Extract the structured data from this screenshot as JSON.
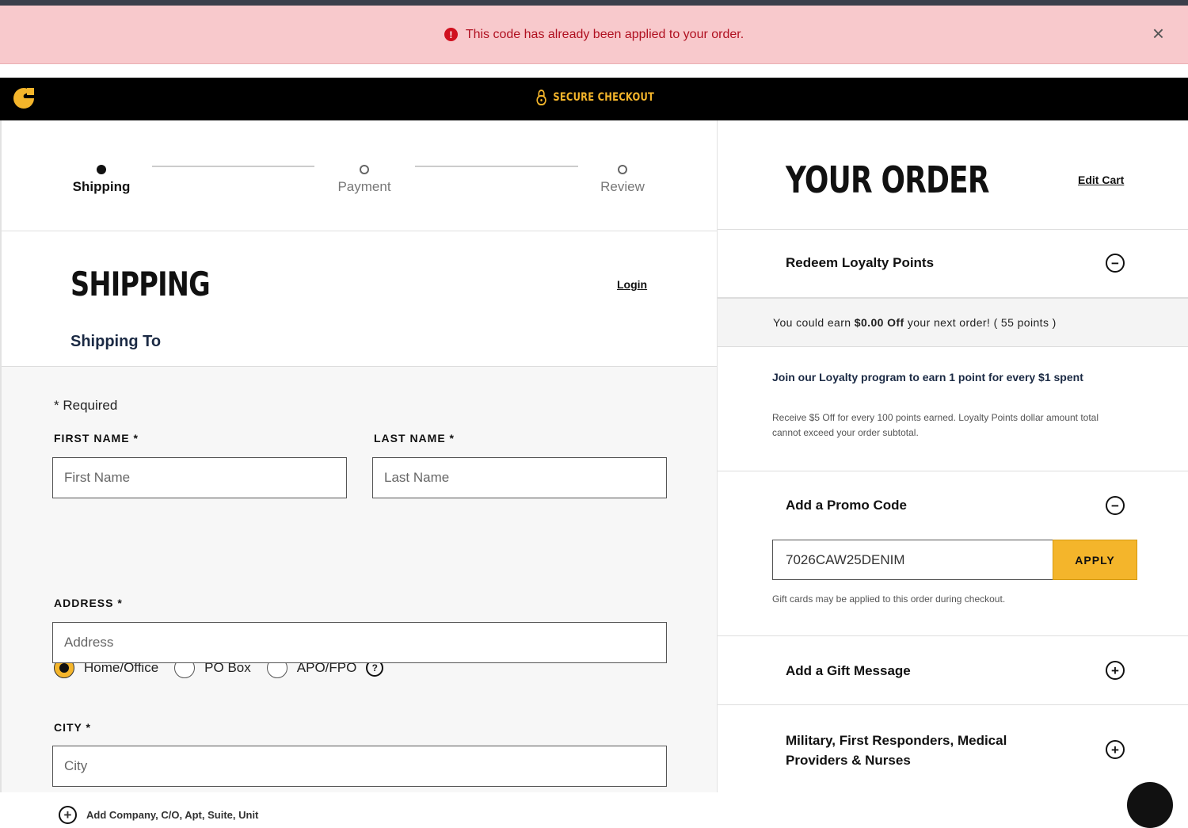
{
  "alert": {
    "message": "This code has already been applied to your order.",
    "icon": "error-icon",
    "close": "×"
  },
  "header": {
    "secure_label": "SECURE CHECKOUT",
    "accent": "#f4b52b"
  },
  "stepper": {
    "steps": [
      {
        "label": "Shipping",
        "active": true
      },
      {
        "label": "Payment",
        "active": false
      },
      {
        "label": "Review",
        "active": false
      }
    ]
  },
  "shipping": {
    "title": "SHIPPING",
    "login": "Login",
    "shipping_to": "Shipping To",
    "required_note": "* Required",
    "first_name_label": "FIRST NAME *",
    "first_name_placeholder": "First Name",
    "last_name_label": "LAST NAME *",
    "last_name_placeholder": "Last Name",
    "address_types": [
      "Home/Office",
      "PO Box",
      "APO/FPO"
    ],
    "selected_address_type": "Home/Office",
    "help": "?",
    "address_label": "ADDRESS *",
    "address_placeholder": "Address",
    "add_company": "Add Company, C/O, Apt, Suite, Unit",
    "city_label": "CITY *",
    "city_placeholder": "City"
  },
  "order": {
    "title": "YOUR ORDER",
    "edit_cart": "Edit Cart",
    "loyalty": {
      "title": "Redeem Loyalty Points",
      "earn_prefix": "You could earn ",
      "earn_amount": "$0.00 Off",
      "earn_suffix": " your next order! ( 55 points )",
      "join_title": "Join our Loyalty program to earn 1 point for every $1 spent",
      "description": "Receive $5 Off for every 100 points earned. Loyalty Points dollar amount total cannot exceed your order subtotal."
    },
    "promo": {
      "title": "Add a Promo Code",
      "code_value": "7026CAW25DENIM",
      "apply": "APPLY",
      "note": "Gift cards may be applied to this order during checkout."
    },
    "gift_message": {
      "title": "Add a Gift Message"
    },
    "military": {
      "title": "Military, First Responders, Medical Providers & Nurses"
    },
    "toggle_minus": "−",
    "toggle_plus": "+"
  }
}
